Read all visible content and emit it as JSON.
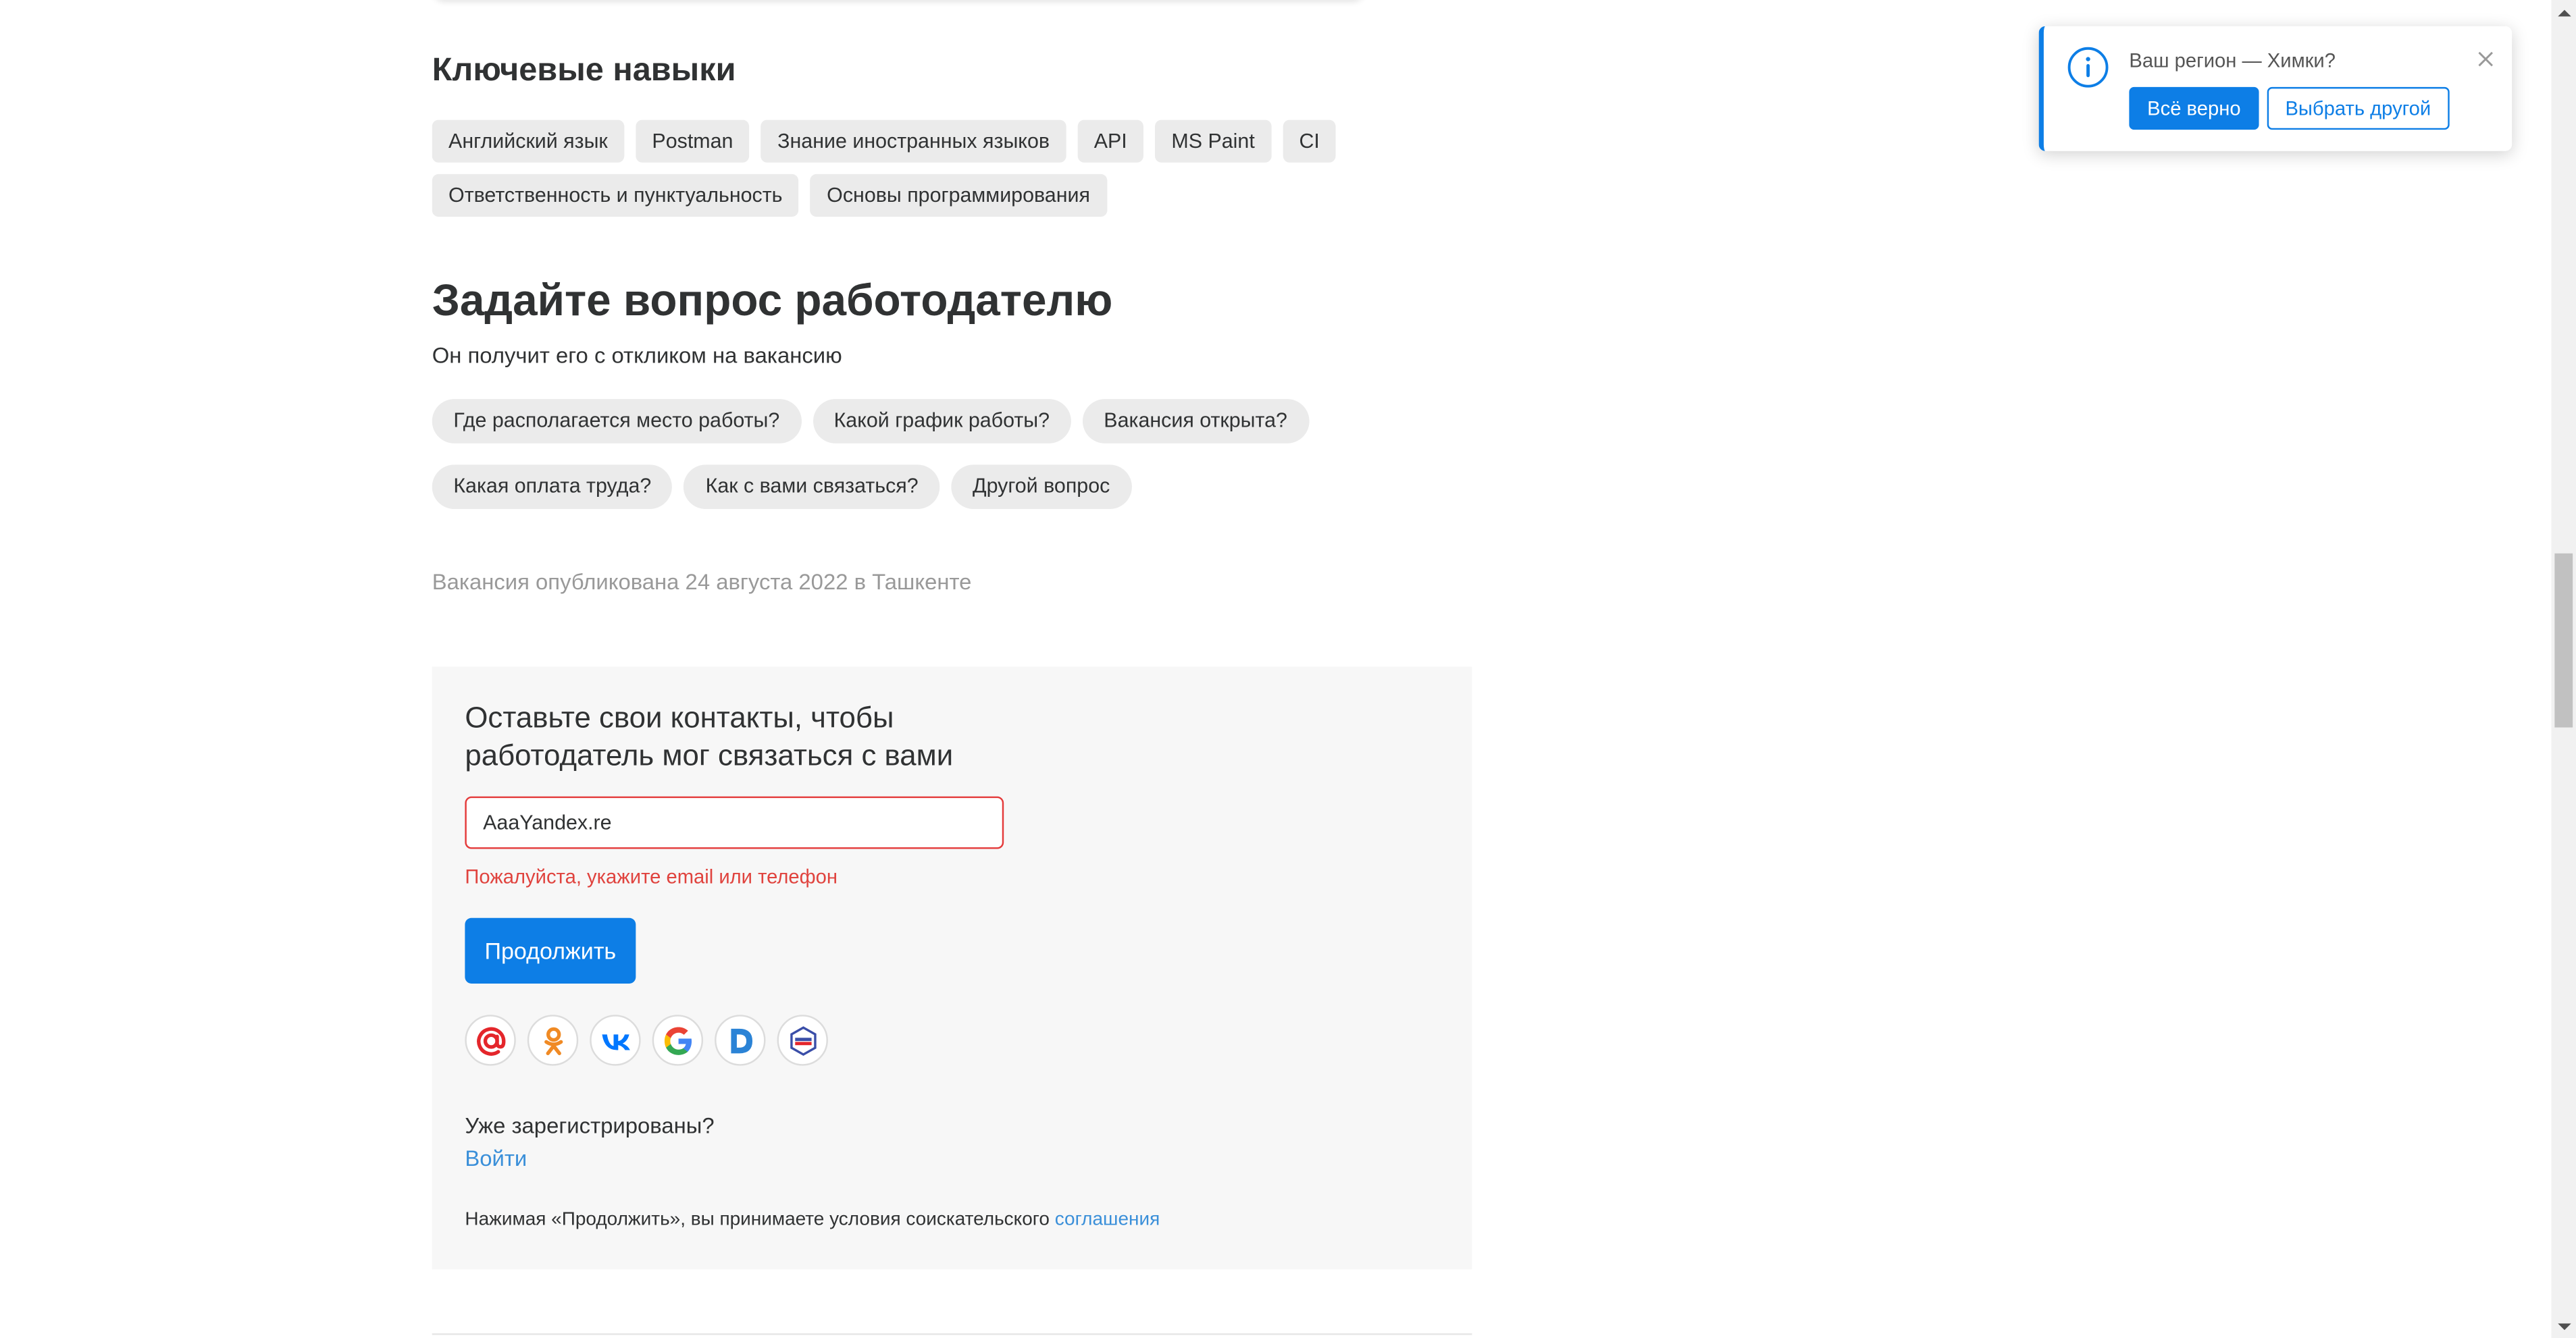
{
  "skills": {
    "title": "Ключевые навыки",
    "items": [
      "Английский язык",
      "Postman",
      "Знание иностранных языков",
      "API",
      "MS Paint",
      "CI",
      "Ответственность и пунктуальность",
      "Основы программирования"
    ]
  },
  "ask": {
    "title": "Задайте вопрос работодателю",
    "subtitle": "Он получит его с откликом на вакансию",
    "questions": [
      "Где располагается место работы?",
      "Какой график работы?",
      "Вакансия открыта?",
      "Какая оплата труда?",
      "Как с вами связаться?",
      "Другой вопрос"
    ]
  },
  "published": "Вакансия опубликована 24 августа 2022 в Ташкенте",
  "contact": {
    "title": "Оставьте свои контакты, чтобы работодатель мог связаться с вами",
    "input_value": "AaaYandex.re",
    "error": "Пожалуйста, укажите email или телефон",
    "continue_label": "Продолжить",
    "socials": [
      "mail-ru-icon",
      "odnoklassniki-icon",
      "vk-icon",
      "google-icon",
      "d-icon",
      "gosuslugi-icon"
    ],
    "already_registered": "Уже зарегистрированы?",
    "login_label": "Войти",
    "terms_text": "Нажимая «Продолжить», вы принимаете условия соискательского ",
    "terms_link": "соглашения"
  },
  "region": {
    "question": "Ваш регион — Химки?",
    "confirm_label": "Всё верно",
    "other_label": "Выбрать другой"
  },
  "colors": {
    "accent": "#0d7ee6",
    "error": "#e0433e",
    "link": "#3a8fd9"
  }
}
